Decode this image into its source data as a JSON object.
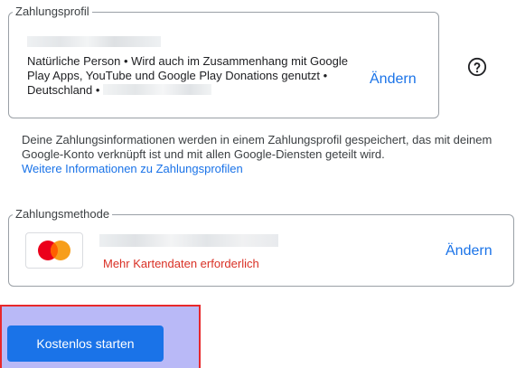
{
  "profile": {
    "legend": "Zahlungsprofil",
    "description": "Natürliche Person • Wird auch im Zusammenhang mit Google Play Apps, YouTube und Google Play Donations genutzt • Deutschland • ",
    "change_label": "Ändern",
    "help_icon": "help-circle-icon"
  },
  "info": {
    "text": "Deine Zahlungsinformationen werden in einem Zahlungsprofil gespeichert, das mit deinem Google-Konto verknüpft ist und mit allen Google-Diensten geteilt wird. ",
    "link_label": "Weitere Informationen zu Zahlungsprofilen"
  },
  "method": {
    "legend": "Zahlungsmethode",
    "card_brand_icon": "mastercard-icon",
    "error": "Mehr Kartendaten erforderlich",
    "change_label": "Ändern"
  },
  "start": {
    "button_label": "Kostenlos starten"
  },
  "colors": {
    "accent": "#1a73e8",
    "error": "#d93025",
    "highlight": "#b9b9f7",
    "highlight_border": "#e8282b"
  }
}
